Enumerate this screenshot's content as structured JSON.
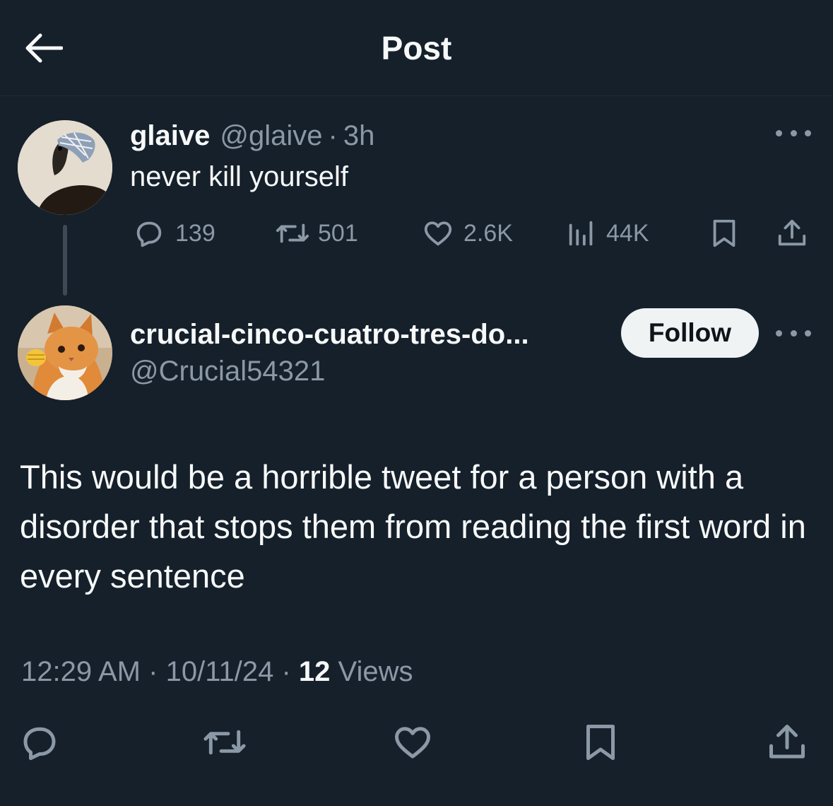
{
  "header": {
    "title": "Post",
    "back_icon": "back-arrow-icon"
  },
  "parent_tweet": {
    "display_name": "glaive",
    "handle": "@glaive",
    "separator": "·",
    "time": "3h",
    "text": "never kill yourself",
    "stats": {
      "replies": "139",
      "reposts": "501",
      "likes": "2.6K",
      "views": "44K"
    }
  },
  "reply": {
    "display_name": "crucial-cinco-cuatro-tres-do...",
    "handle": "@Crucial54321",
    "follow_label": "Follow",
    "text": "This would be a horrible tweet for a person with a disorder that stops them from reading the first word in every sentence",
    "time": "12:29 AM",
    "date": "10/11/24",
    "separator": "·",
    "views_count": "12",
    "views_label": "Views"
  },
  "colors": {
    "background": "#15202b",
    "primary_text": "#f7f9f9",
    "secondary_text": "#8b98a5",
    "follow_button_bg": "#eff3f4"
  },
  "icons": {
    "reply": "reply-bubble-icon",
    "repost": "repost-icon",
    "like": "heart-icon",
    "views": "bar-chart-icon",
    "bookmark": "bookmark-icon",
    "share": "share-icon",
    "more": "more-dots-icon"
  }
}
